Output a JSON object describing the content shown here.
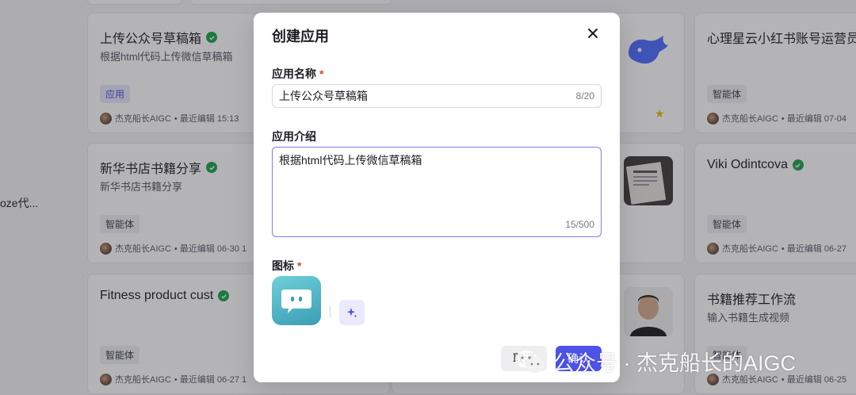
{
  "sidebar": {
    "truncated_item": "oze代..."
  },
  "cards": [
    {
      "title": "上传公众号草稿箱",
      "verified": true,
      "desc": "根据html代码上传微信草稿箱",
      "tag": "应用",
      "tag_type": "app",
      "author": "杰克船长AIGC",
      "edited": "• 最近编辑 15:13"
    },
    {
      "title": "新华书店书籍分享",
      "verified": true,
      "desc": "新华书店书籍分享",
      "tag": "智能体",
      "tag_type": "agent",
      "author": "杰克船长AIGC",
      "edited": "• 最近编辑 06-30 1"
    },
    {
      "title": "Fitness product cust",
      "verified": true,
      "desc": "",
      "tag": "智能体",
      "tag_type": "agent",
      "author": "杰克船长AIGC",
      "edited": "• 最近编辑 06-27 1"
    },
    {
      "title": "心理星云小红书账号运营员工",
      "verified": false,
      "desc": "",
      "tag": "智能体",
      "tag_type": "agent",
      "author": "杰克船长AIGC",
      "edited": "• 最近编辑 07-04"
    },
    {
      "title": "Viki Odintcova",
      "verified": true,
      "desc": "",
      "tag": "智能体",
      "tag_type": "agent",
      "author": "杰克船长AIGC",
      "edited": "• 最近编辑 06-27"
    },
    {
      "title": "书籍推荐工作流",
      "verified": false,
      "desc": "输入书籍生成视频",
      "tag": "智能体",
      "tag_type": "agent",
      "author": "杰克船长AIGC",
      "edited": "• 最近编辑 06-25"
    }
  ],
  "modal": {
    "title": "创建应用",
    "name_label": "应用名称",
    "required_mark": "*",
    "name_value": "上传公众号草稿箱",
    "name_count": "8/20",
    "intro_label": "应用介绍",
    "intro_value": "根据html代码上传微信草稿箱",
    "intro_count": "15/500",
    "icon_label": "图标",
    "cancel_label": "取消",
    "confirm_label": "确认"
  },
  "watermark": {
    "text": "公众号 · 杰克船长的AIGC"
  },
  "colors": {
    "primary": "#4d53e8",
    "verified": "#1ba34a",
    "required": "#e0452f"
  }
}
